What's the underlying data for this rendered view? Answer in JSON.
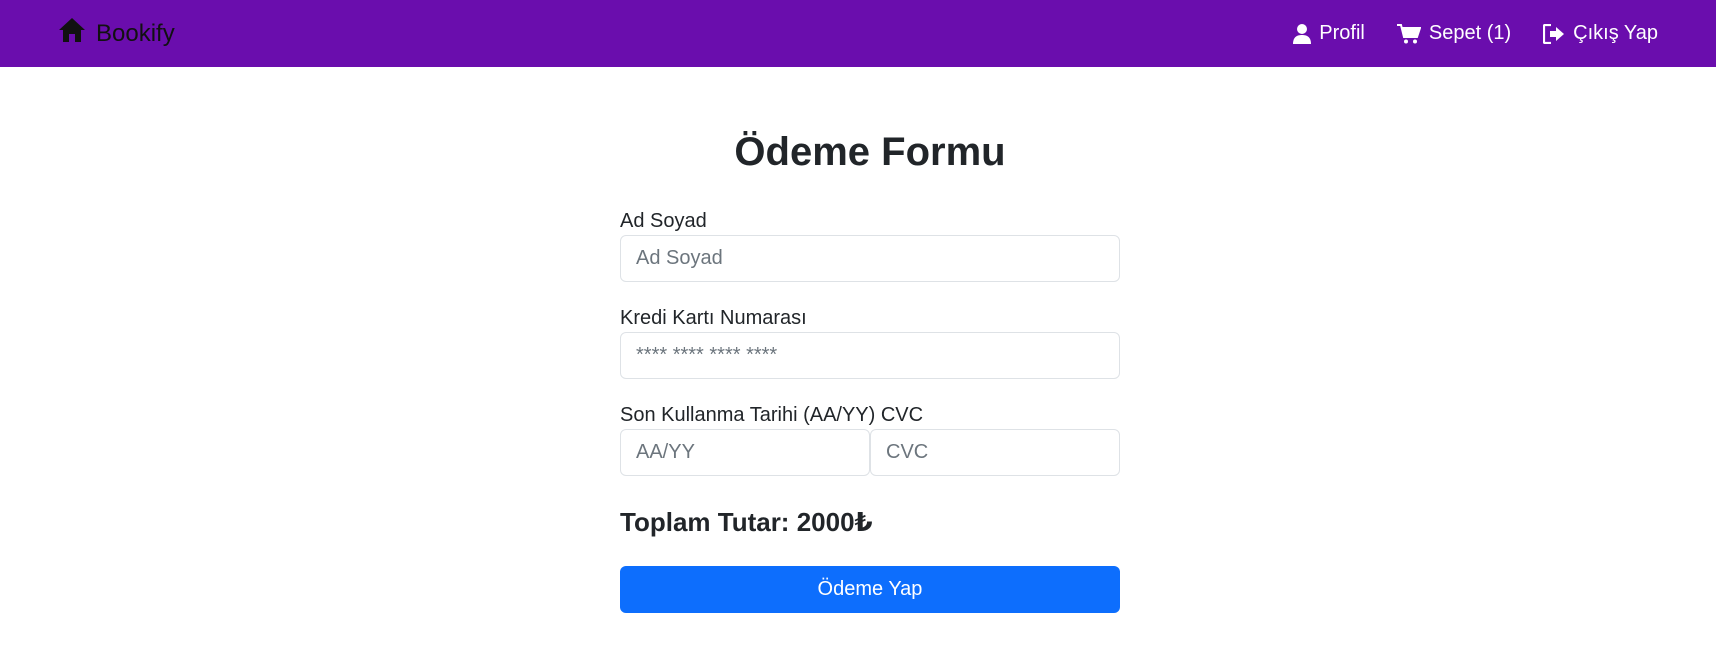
{
  "navbar": {
    "brand": "Bookify",
    "background": "#6a0dad",
    "brand_icon": "home-icon",
    "links": [
      {
        "label": "Profil",
        "icon": "user-icon"
      },
      {
        "label": "Sepet (1)",
        "icon": "cart-icon"
      },
      {
        "label": "Çıkış Yap",
        "icon": "logout-icon"
      }
    ]
  },
  "form": {
    "title": "Ödeme Formu",
    "name_label": "Ad Soyad",
    "name_placeholder": "Ad Soyad",
    "card_label": "Kredi Kartı Numarası",
    "card_placeholder": "**** **** **** ****",
    "expiry_cvc_label": "Son Kullanma Tarihi (AA/YY) CVC",
    "expiry_placeholder": "AA/YY",
    "cvc_placeholder": "CVC",
    "total": "Toplam Tutar: 2000₺",
    "submit_label": "Ödeme Yap",
    "submit_color": "#0d6efd"
  }
}
